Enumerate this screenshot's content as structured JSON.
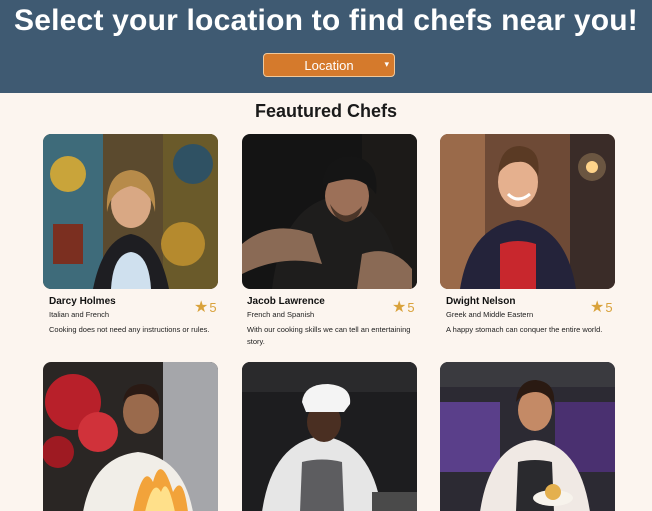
{
  "hero": {
    "title": "Select your location to find chefs near you!",
    "location_select": "Location"
  },
  "section_title": "Feautured Chefs",
  "chefs": [
    {
      "name": "Darcy Holmes",
      "cuisine": "Italian and French",
      "rating": "5",
      "bio": "Cooking does not need any instructions or rules."
    },
    {
      "name": "Jacob Lawrence",
      "cuisine": "French and Spanish",
      "rating": "5",
      "bio": "With our cooking skills we can tell an entertaining story."
    },
    {
      "name": "Dwight Nelson",
      "cuisine": "Greek and Middle Eastern",
      "rating": "5",
      "bio": "A happy stomach can conquer the entire world."
    }
  ],
  "colors": {
    "hero_bg": "#3f5a72",
    "select_bg": "#d57a2c",
    "star": "#d9a23b",
    "page_bg": "#fcf5ef"
  },
  "icons": {
    "rating": "star-icon",
    "dropdown": "chevron-down-icon"
  }
}
